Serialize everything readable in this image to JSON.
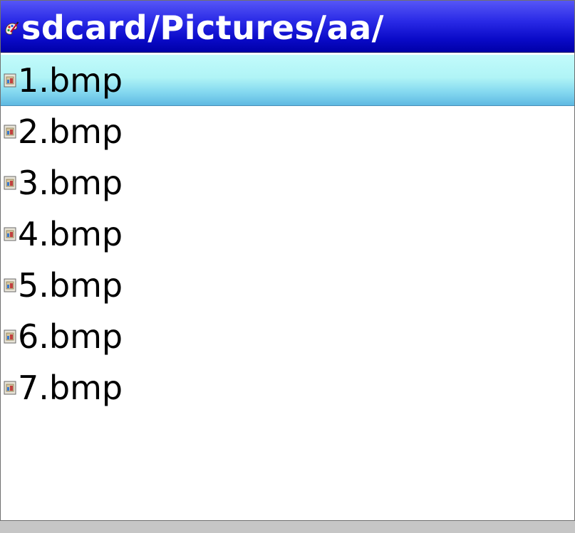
{
  "window": {
    "title": "sdcard/Pictures/aa/",
    "title_icon": "paint-palette-icon"
  },
  "files": [
    {
      "name": "1.bmp",
      "icon": "bmp-file-icon",
      "selected": true
    },
    {
      "name": "2.bmp",
      "icon": "bmp-file-icon",
      "selected": false
    },
    {
      "name": "3.bmp",
      "icon": "bmp-file-icon",
      "selected": false
    },
    {
      "name": "4.bmp",
      "icon": "bmp-file-icon",
      "selected": false
    },
    {
      "name": "5.bmp",
      "icon": "bmp-file-icon",
      "selected": false
    },
    {
      "name": "6.bmp",
      "icon": "bmp-file-icon",
      "selected": false
    },
    {
      "name": "7.bmp",
      "icon": "bmp-file-icon",
      "selected": false
    }
  ],
  "colors": {
    "titlebar": "#1a1ad6",
    "selection": "#b0f4f6",
    "background": "#ffffff"
  }
}
